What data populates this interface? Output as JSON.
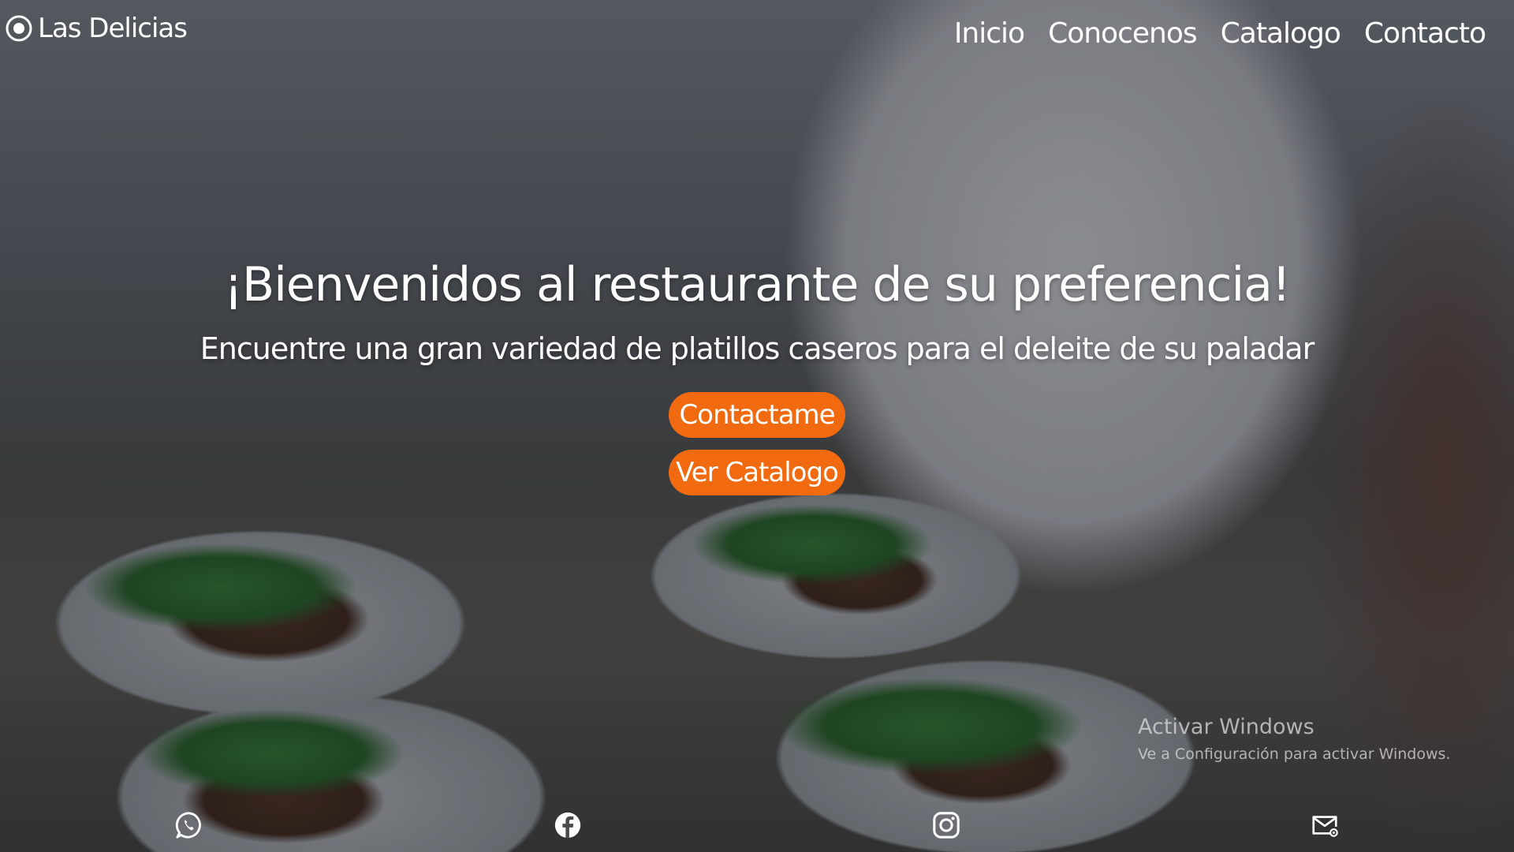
{
  "brand": {
    "name": "Las Delicias",
    "icon": "flower-logo-icon"
  },
  "nav": {
    "items": [
      {
        "label": "Inicio"
      },
      {
        "label": "Conocenos"
      },
      {
        "label": "Catalogo"
      },
      {
        "label": "Contacto"
      }
    ]
  },
  "hero": {
    "headline": "¡Bienvenidos al restaurante de su preferencia!",
    "subheadline": "Encuentre una gran variedad de platillos caseros para el deleite de su paladar",
    "contact_button": "Contactame",
    "catalog_button": "Ver Catalogo",
    "accent_color": "#f26a0f"
  },
  "watermark": {
    "title": "Activar Windows",
    "subtitle": "Ve a Configuración para activar Windows."
  },
  "social": {
    "icons": [
      "whatsapp-icon",
      "facebook-icon",
      "instagram-icon",
      "email-icon"
    ]
  }
}
